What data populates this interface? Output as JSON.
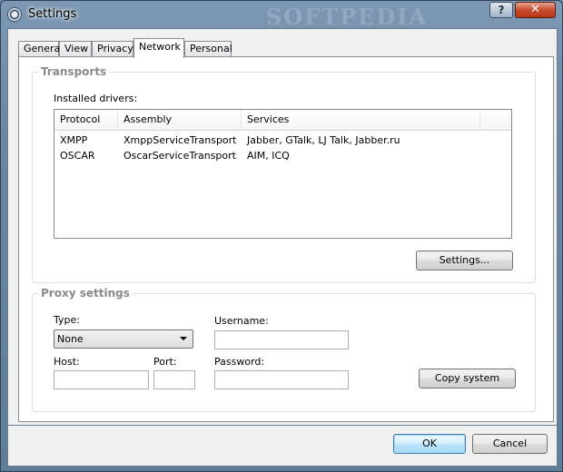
{
  "window": {
    "title": "Settings",
    "watermark": "SOFTPEDIA",
    "help_glyph": "?",
    "close_glyph": "✕"
  },
  "tabs": [
    {
      "label": "General"
    },
    {
      "label": "View"
    },
    {
      "label": "Privacy"
    },
    {
      "label": "Network",
      "active": true
    },
    {
      "label": "Personal"
    }
  ],
  "transports": {
    "title": "Transports",
    "installed_drivers_label": "Installed drivers:",
    "columns": [
      "Protocol",
      "Assembly",
      "Services"
    ],
    "rows": [
      {
        "protocol": "XMPP",
        "assembly": "XmppServiceTransport",
        "services": "Jabber, GTalk, LJ Talk, Jabber.ru"
      },
      {
        "protocol": "OSCAR",
        "assembly": "OscarServiceTransport",
        "services": "AIM, ICQ"
      }
    ],
    "settings_button": "Settings..."
  },
  "proxy": {
    "title": "Proxy settings",
    "type_label": "Type:",
    "type_value": "None",
    "host_label": "Host:",
    "port_label": "Port:",
    "username_label": "Username:",
    "password_label": "Password:",
    "host_value": "",
    "port_value": "",
    "username_value": "",
    "password_value": "",
    "copy_system_button": "Copy system"
  },
  "footer": {
    "ok_button": "OK",
    "cancel_button": "Cancel"
  }
}
